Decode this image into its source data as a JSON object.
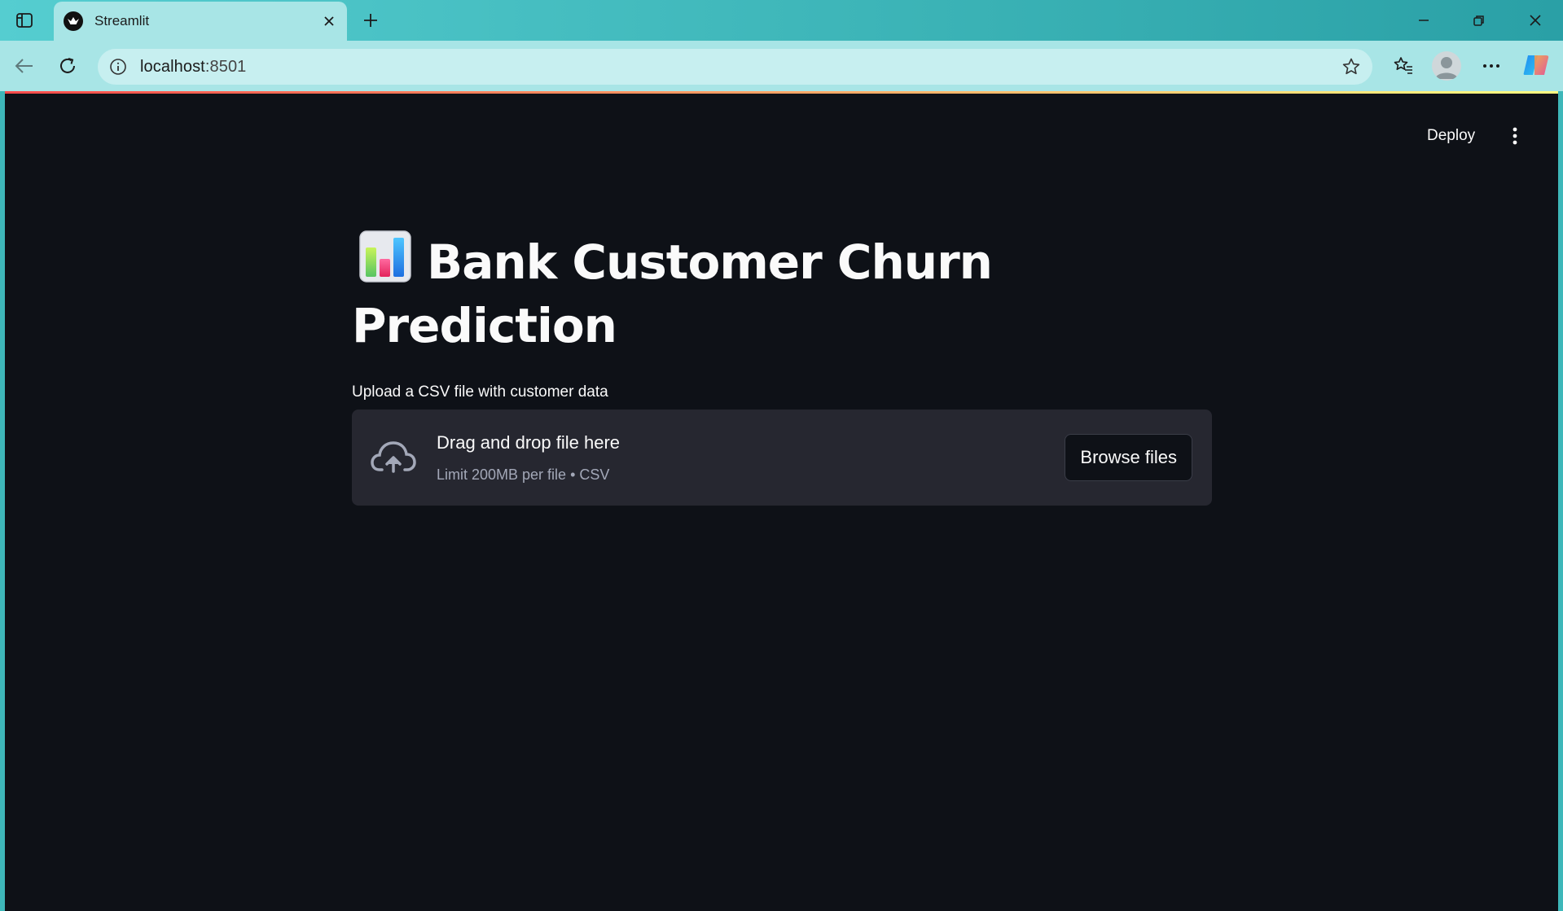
{
  "browser": {
    "tab_title": "Streamlit",
    "address_host": "localhost",
    "address_port": ":8501"
  },
  "app": {
    "deploy_label": "Deploy",
    "title": "Bank Customer Churn Prediction",
    "title_icon": "bar-chart-emoji",
    "uploader": {
      "label": "Upload a CSV file with customer data",
      "drop_text": "Drag and drop file here",
      "limit_text": "Limit 200MB per file • CSV",
      "browse_label": "Browse files"
    }
  },
  "colors": {
    "app_background": "#0e1117",
    "dropzone_background": "#262730",
    "text": "#fafafa",
    "muted_text": "#a3a8b8",
    "browser_chrome": "#a8e5e6"
  }
}
